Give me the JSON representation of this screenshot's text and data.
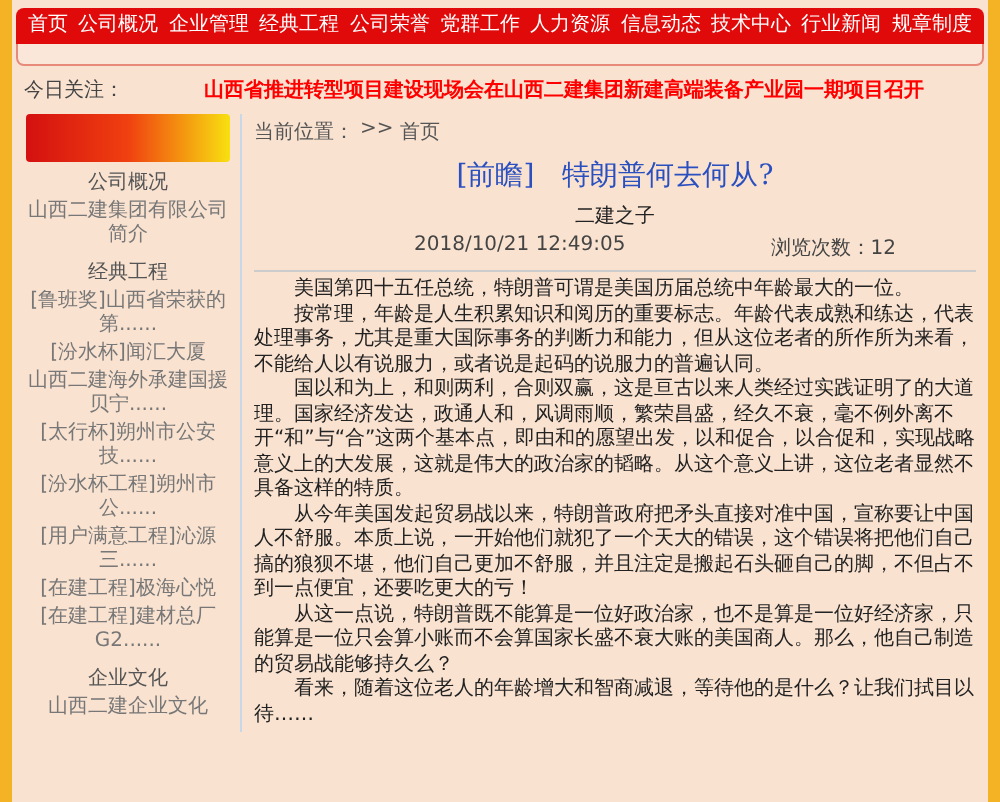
{
  "nav": [
    "首页",
    "公司概况",
    "企业管理",
    "经典工程",
    "公司荣誉",
    "党群工作",
    "人力资源",
    "信息动态",
    "技术中心",
    "行业新闻",
    "规章制度"
  ],
  "focus": {
    "label": "今日关注：",
    "headline": "山西省推进转型项目建设现场会在山西二建集团新建高端装备产业园一期项目召开"
  },
  "sidebar": {
    "sections": [
      {
        "heading": "公司概况",
        "items": [
          "山西二建集团有限公司简介"
        ]
      },
      {
        "heading": "经典工程",
        "items": [
          "[鲁班奖]山西省荣获的第......",
          "[汾水杯]闻汇大厦",
          "山西二建海外承建国援贝宁......",
          "[太行杯]朔州市公安技......",
          "[汾水杯工程]朔州市公......",
          "[用户满意工程]沁源三......",
          "[在建工程]极海心悦",
          "[在建工程]建材总厂G2......"
        ]
      },
      {
        "heading": "企业文化",
        "items": [
          "山西二建企业文化"
        ]
      }
    ]
  },
  "breadcrumb": {
    "label": "当前位置：",
    "separator": ">>",
    "link": "首页"
  },
  "article": {
    "tag": "[前瞻]",
    "title": "特朗普何去何从?",
    "author": "二建之子",
    "date": "2018/10/21  12:49:05",
    "views": "浏览次数：12",
    "paragraphs": [
      "美国第四十五任总统，特朗普可谓是美国历届总统中年龄最大的一位。",
      "按常理，年龄是人生积累知识和阅历的重要标志。年龄代表成熟和练达，代表处理事务，尤其是重大国际事务的判断力和能力，但从这位老者的所作所为来看，不能给人以有说服力，或者说是起码的说服力的普遍认同。",
      "国以和为上，和则两利，合则双赢，这是亘古以来人类经过实践证明了的大道理。国家经济发达，政通人和，风调雨顺，繁荣昌盛，经久不衰，毫不例外离不开“和”与“合”这两个基本点，即由和的愿望出发，以和促合，以合促和，实现战略意义上的大发展，这就是伟大的政治家的韬略。从这个意义上讲，这位老者显然不具备这样的特质。",
      "从今年美国发起贸易战以来，特朗普政府把矛头直接对准中国，宣称要让中国人不舒服。本质上说，一开始他们就犯了一个天大的错误，这个错误将把他们自己搞的狼狈不堪，他们自己更加不舒服，并且注定是搬起石头砸自己的脚，不但占不到一点便宜，还要吃更大的亏！",
      "从这一点说，特朗普既不能算是一位好政治家，也不是算是一位好经济家，只能算是一位只会算小账而不会算国家长盛不衰大账的美国商人。那么，他自己制造的贸易战能够持久么？",
      "看来，随着这位老人的年龄增大和智商减退，等待他的是什么？让我们拭目以待……"
    ]
  }
}
